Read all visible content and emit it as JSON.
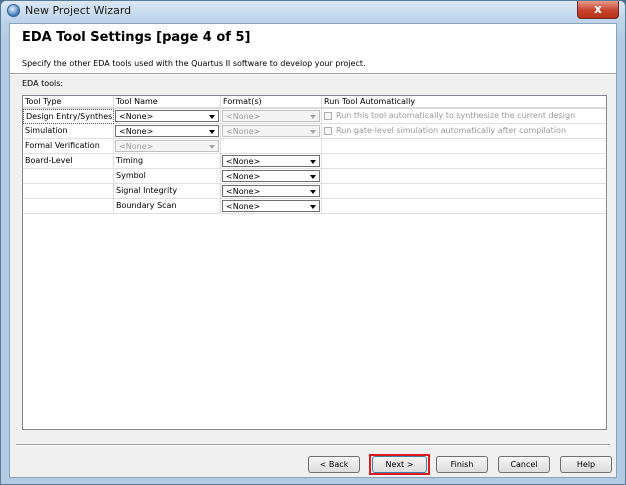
{
  "window": {
    "title": "New Project Wizard",
    "close_label": "x"
  },
  "header": {
    "title": "EDA Tool Settings [page 4 of 5]",
    "description": "Specify the other EDA tools used with the Quartus II software to develop your project."
  },
  "section_label": "EDA tools:",
  "table": {
    "columns": [
      "Tool Type",
      "Tool Name",
      "Format(s)",
      "Run Tool Automatically"
    ],
    "rows": [
      {
        "tool_type": "Design Entry/Synthesis",
        "tool_name": "<None>",
        "format": "<None>",
        "run_label": "Run this tool automatically to synthesize the current design"
      },
      {
        "tool_type": "Simulation",
        "tool_name": "<None>",
        "format": "<None>",
        "run_label": "Run gate-level simulation automatically after compilation"
      },
      {
        "tool_type": "Formal Verification",
        "tool_name": "<None>"
      },
      {
        "tool_type": "Board-Level",
        "tool_name": "Timing",
        "format": "<None>"
      },
      {
        "tool_name": "Symbol",
        "format": "<None>"
      },
      {
        "tool_name": "Signal Integrity",
        "format": "<None>"
      },
      {
        "tool_name": "Boundary Scan",
        "format": "<None>"
      }
    ]
  },
  "buttons": {
    "back": "< Back",
    "next": "Next >",
    "finish": "Finish",
    "cancel": "Cancel",
    "help": "Help"
  },
  "colors": {
    "highlight": "#e0191d",
    "close_button": "#c8442c"
  }
}
